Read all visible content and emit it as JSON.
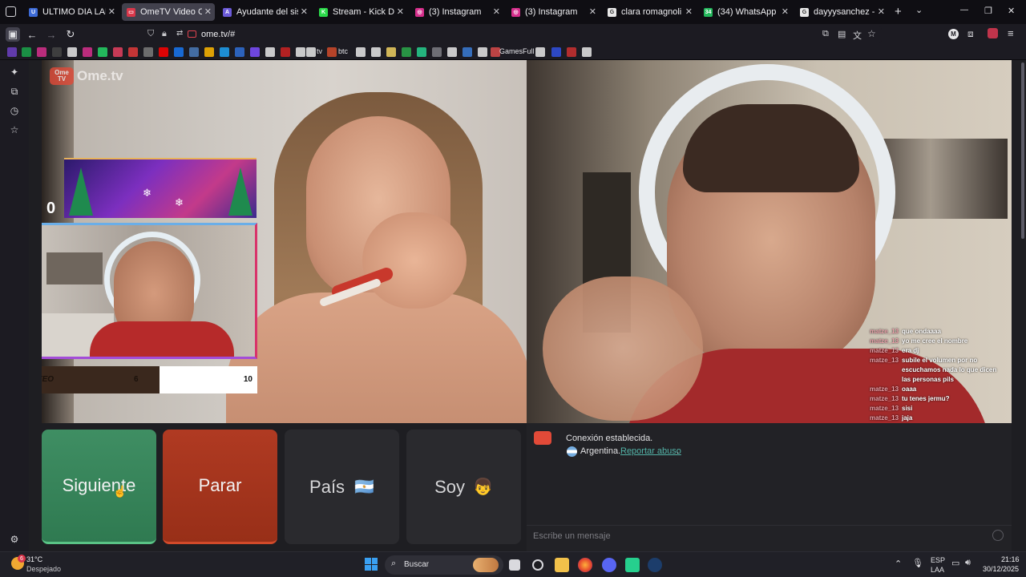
{
  "browser": {
    "tabs": [
      {
        "label": "ULTIMO DIA LABORAL",
        "color": "#3d6bd7",
        "glyph": "U",
        "active": false
      },
      {
        "label": "OmeTV Video Cha",
        "color": "#d8374a",
        "glyph": "▭",
        "active": true
      },
      {
        "label": "Ayudante del sistema d",
        "color": "#6b5ad8",
        "glyph": "A",
        "active": false
      },
      {
        "label": "Stream - Kick Dash",
        "color": "#2bd94a",
        "glyph": "K",
        "active": false
      },
      {
        "label": "(3) Instagram",
        "color": "#d62f8c",
        "glyph": "◎",
        "active": false
      },
      {
        "label": "(3) Instagram",
        "color": "#d62f8c",
        "glyph": "◎",
        "active": false
      },
      {
        "label": "clara romagnoli - Busca",
        "color": "#e8e8e8",
        "glyph": "G",
        "active": false
      },
      {
        "label": "(34) WhatsApp",
        "color": "#24b85c",
        "glyph": "34",
        "active": false
      },
      {
        "label": "dayyysanchez - Buscar",
        "color": "#e8e8e8",
        "glyph": "G",
        "active": false
      }
    ],
    "new_tab": "+",
    "url": "ome.tv/#",
    "bookmarks_text": [
      "tv",
      "btc",
      "GamesFull"
    ],
    "window_controls": [
      "—",
      "❐",
      "✕"
    ],
    "profile_letter": "M"
  },
  "ometv": {
    "logo_text": "Ome.tv",
    "logo_badge": "Ome TV",
    "counter": "0",
    "sorteo_label": "SORTEO",
    "sorteo_left_value": "6",
    "sorteo_right_value": "10",
    "buttons": {
      "next": "Siguiente",
      "stop": "Parar",
      "country": "País",
      "country_flag": "🇦🇷",
      "gender": "Soy",
      "gender_emoji": "👦"
    },
    "chat": {
      "connected": "Conexión establecida.",
      "country": "Argentina.",
      "report": "Reportar abuso",
      "report_tail": ".",
      "input_placeholder": "Escribe un mensaje"
    },
    "overlay_chat": [
      {
        "user": "matze_13",
        "msg": "que ondaaaa"
      },
      {
        "user": "matze_13",
        "msg": "yo me cree el nombre"
      },
      {
        "user": "matze_13",
        "msg": "era dj"
      },
      {
        "user": "matze_13",
        "msg": "subile el volumen por no escuchamos nada lo que dicen las personas pils"
      },
      {
        "user": "matze_13",
        "msg": "oaaa"
      },
      {
        "user": "matze_13",
        "msg": "tu tenes jermu?"
      },
      {
        "user": "matze_13",
        "msg": "sisi"
      },
      {
        "user": "matze_13",
        "msg": "jaja"
      }
    ]
  },
  "taskbar": {
    "weather_temp": "31°C",
    "weather_desc": "Despejado",
    "weather_badge": "6",
    "search": "Buscar",
    "lang1": "ESP",
    "lang2": "LAA",
    "time": "21:16",
    "date": "30/12/2025"
  }
}
